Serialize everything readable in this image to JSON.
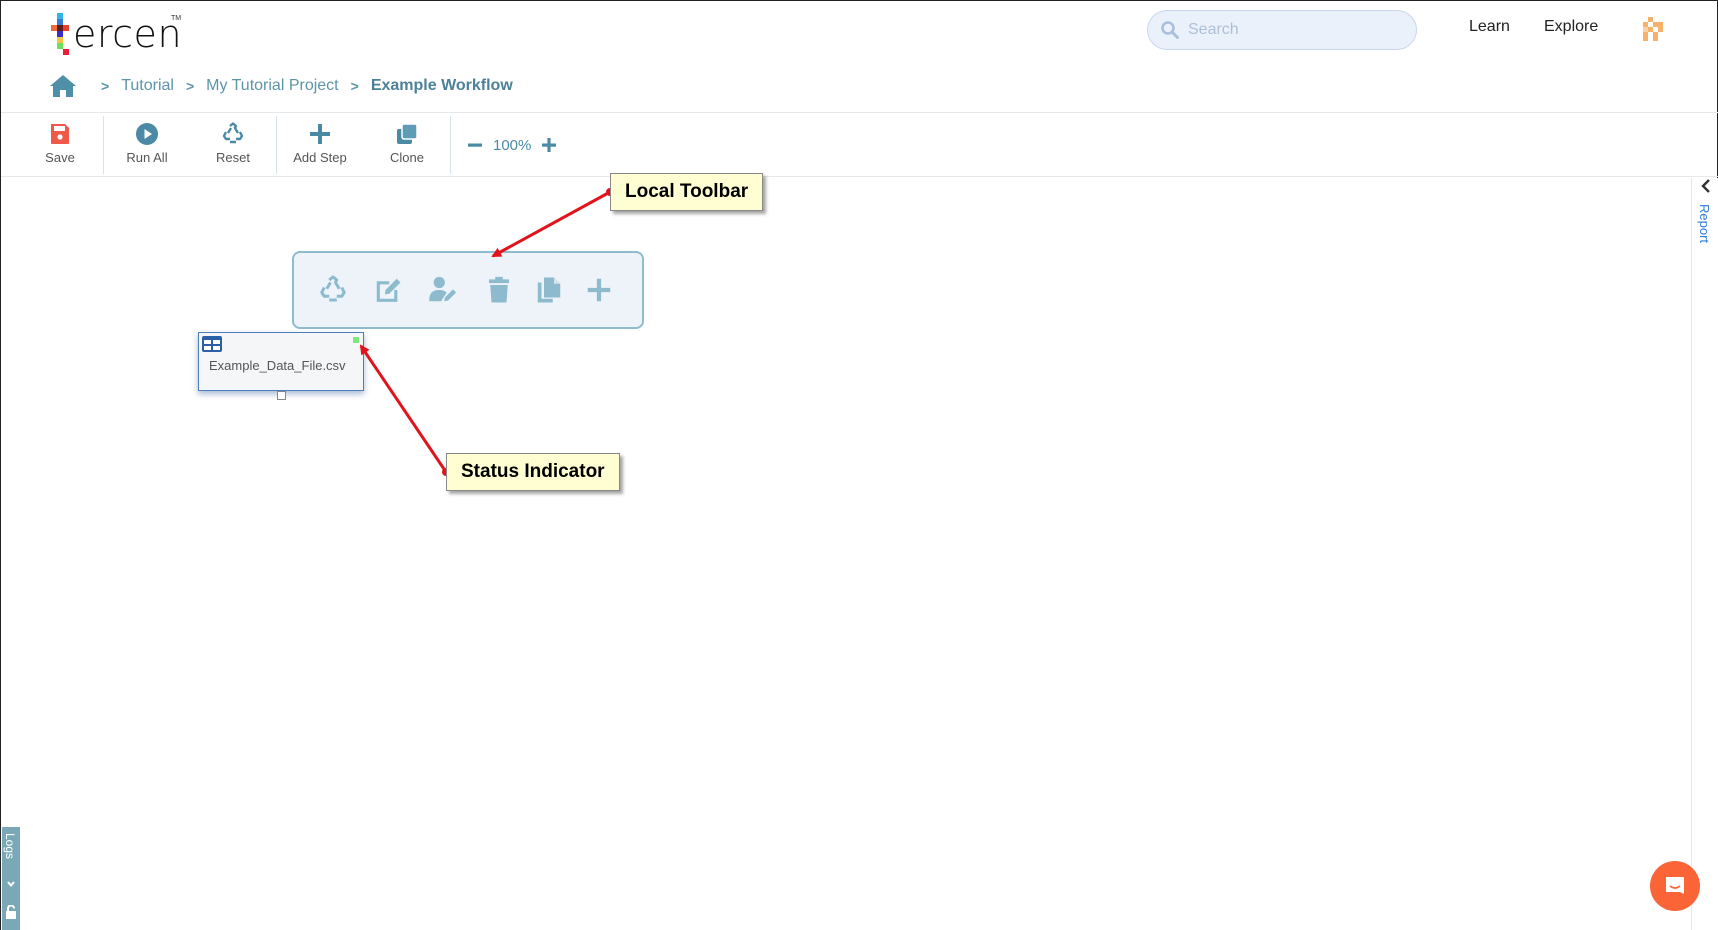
{
  "app": {
    "logo_text": "ercen",
    "logo_tm": "TM",
    "brand_colors": {
      "accent": "#4b8aa5",
      "save": "#f0584a",
      "chat": "#fa6436",
      "status_ok": "#7ee67a"
    }
  },
  "header": {
    "search": {
      "placeholder": "Search",
      "value": ""
    },
    "nav": [
      {
        "label": "Learn"
      },
      {
        "label": "Explore"
      }
    ],
    "avatar_icon": "pixel-avatar-icon"
  },
  "breadcrumb": {
    "home_icon": "home-icon",
    "separator": ">",
    "items": [
      {
        "label": "Tutorial"
      },
      {
        "label": "My Tutorial Project"
      },
      {
        "label": "Example Workflow"
      }
    ]
  },
  "toolbar": {
    "buttons": [
      {
        "label": "Save",
        "icon": "save-icon"
      },
      {
        "label": "Run All",
        "icon": "play-circle-icon"
      },
      {
        "label": "Reset",
        "icon": "recycle-icon"
      },
      {
        "label": "Add Step",
        "icon": "plus-icon"
      },
      {
        "label": "Clone",
        "icon": "clone-icon"
      }
    ],
    "zoom": {
      "value": "100%"
    }
  },
  "right_panel": {
    "label": "Report"
  },
  "local_toolbar": {
    "icons": [
      "recycle-icon",
      "edit-icon",
      "user-edit-icon",
      "trash-icon",
      "copy-icon",
      "plus-icon"
    ]
  },
  "node": {
    "label": "Example_Data_File.csv",
    "icon": "table-icon",
    "status": "ok"
  },
  "annotations": [
    {
      "label": "Local Toolbar"
    },
    {
      "label": "Status Indicator"
    }
  ],
  "logs_tab": {
    "label": "Logs"
  }
}
